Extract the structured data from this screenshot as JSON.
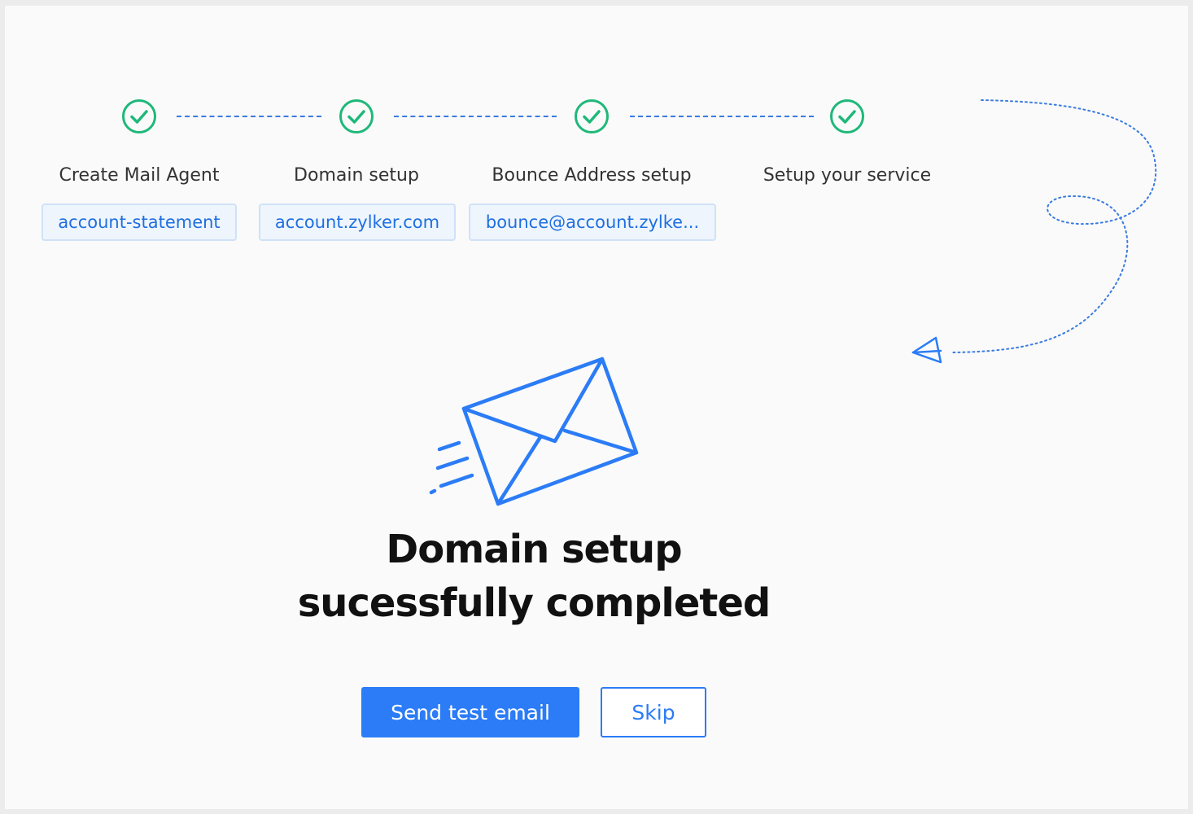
{
  "steps": [
    {
      "label": "Create Mail Agent",
      "chip": "account-statement",
      "status": "completed"
    },
    {
      "label": "Domain setup",
      "chip": "account.zylker.com",
      "status": "completed"
    },
    {
      "label": "Bounce Address setup",
      "chip": "bounce@account.zylke...",
      "status": "completed"
    },
    {
      "label": "Setup your service",
      "status": "completed"
    }
  ],
  "main": {
    "title_line1": "Domain setup",
    "title_line2": "sucessfully completed",
    "send_test_label": "Send test email",
    "skip_label": "Skip"
  },
  "icons": {
    "step_icon": "check-circle-icon",
    "illustration": "envelope-icon",
    "decoration": "paper-plane-icon"
  },
  "colors": {
    "accent": "#2b7cf6",
    "success": "#1fb87a",
    "chip_bg": "#eef5fd",
    "chip_border": "#cfe2f7"
  }
}
